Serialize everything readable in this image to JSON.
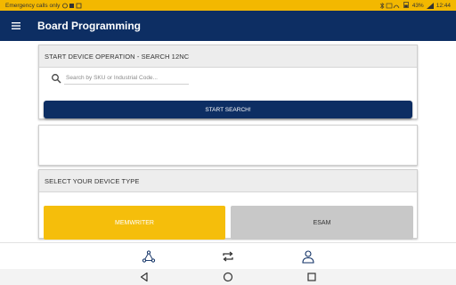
{
  "status_bar": {
    "left_text": "Emergency calls only",
    "battery": "43%",
    "time": "12:44"
  },
  "app_bar": {
    "title": "Board Programming",
    "menu_icon": "hamburger-menu-icon"
  },
  "search_card": {
    "header": "START DEVICE OPERATION - SEARCH 12NC",
    "search_placeholder": "Search by SKU or Industrial Code...",
    "search_value": "",
    "button_label": "START SEARCH!"
  },
  "result_card": {
    "content": ""
  },
  "device_card": {
    "header": "SELECT YOUR DEVICE TYPE",
    "options": [
      {
        "label": "MEMWRITER",
        "selected": true
      },
      {
        "label": "ESAM",
        "selected": false
      }
    ]
  },
  "bottom_nav": {
    "items": [
      {
        "icon": "network-icon"
      },
      {
        "icon": "sync-icon"
      },
      {
        "icon": "profile-icon"
      }
    ]
  },
  "colors": {
    "status_bar": "#f3b800",
    "app_bar": "#0d2e63",
    "primary_button": "#0d2e63",
    "selected_option": "#f5be0b",
    "unselected_option": "#c8c8c8"
  }
}
